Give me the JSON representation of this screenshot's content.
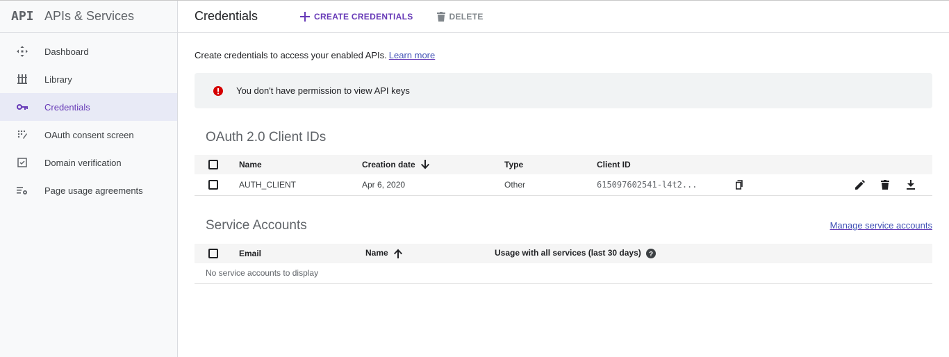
{
  "app": {
    "logo_text": "API",
    "title": "APIs & Services"
  },
  "sidebar": {
    "items": [
      {
        "label": "Dashboard",
        "icon": "dashboard-icon"
      },
      {
        "label": "Library",
        "icon": "library-icon"
      },
      {
        "label": "Credentials",
        "icon": "key-icon",
        "active": true
      },
      {
        "label": "OAuth consent screen",
        "icon": "consent-icon"
      },
      {
        "label": "Domain verification",
        "icon": "domain-verification-icon"
      },
      {
        "label": "Page usage agreements",
        "icon": "settings-list-icon"
      }
    ]
  },
  "toolbar": {
    "title": "Credentials",
    "create_label": "CREATE CREDENTIALS",
    "delete_label": "DELETE"
  },
  "intro": {
    "text": "Create credentials to access your enabled APIs.",
    "link": "Learn more"
  },
  "alert": {
    "text": "You don't have permission to view API keys"
  },
  "oauth": {
    "title": "OAuth 2.0 Client IDs",
    "columns": {
      "name": "Name",
      "creation_date": "Creation date",
      "type": "Type",
      "client_id": "Client ID"
    },
    "rows": [
      {
        "name": "AUTH_CLIENT",
        "creation_date": "Apr 6, 2020",
        "type": "Other",
        "client_id": "615097602541-l4t2..."
      }
    ]
  },
  "service_accounts": {
    "title": "Service Accounts",
    "manage_link": "Manage service accounts",
    "columns": {
      "email": "Email",
      "name": "Name",
      "usage": "Usage with all services (last 30 days)"
    },
    "empty_text": "No service accounts to display"
  },
  "colors": {
    "accent": "#673ab7",
    "error": "#d50000",
    "active_bg": "#e8eaf6"
  }
}
